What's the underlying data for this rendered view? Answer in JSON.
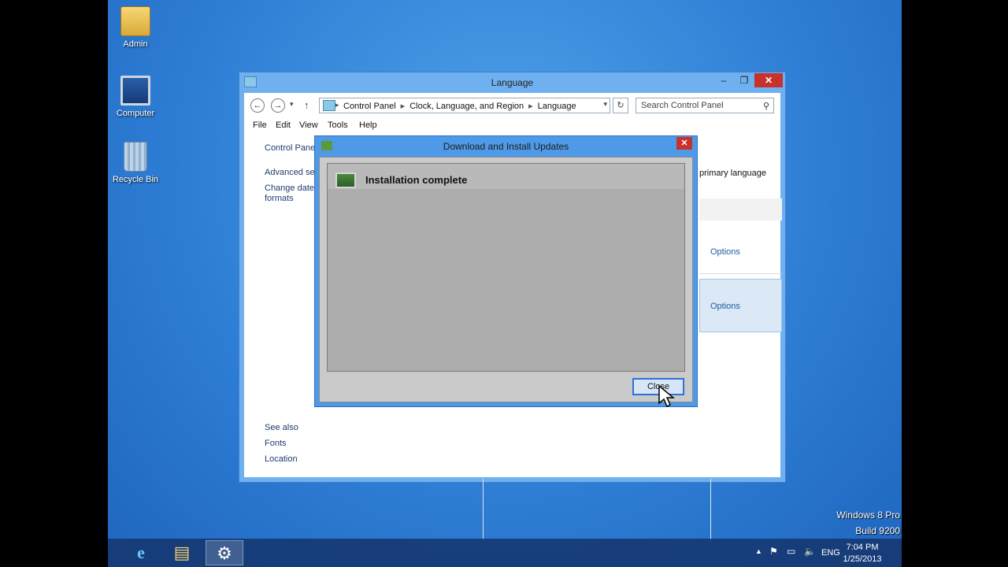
{
  "desktop": {
    "icons": [
      {
        "label": "Admin",
        "icon": "user-folder-icon"
      },
      {
        "label": "Computer",
        "icon": "computer-icon"
      },
      {
        "label": "Recycle Bin",
        "icon": "recycle-bin-icon"
      }
    ]
  },
  "window": {
    "title": "Language",
    "minimize": "–",
    "maximize": "❐",
    "close": "✕",
    "breadcrumb": [
      "Control Panel",
      "Clock, Language, and Region",
      "Language"
    ],
    "search_placeholder": "Search Control Panel",
    "menu": [
      "File",
      "Edit",
      "View",
      "Tools",
      "Help"
    ],
    "left_pane": {
      "home": "Control Panel",
      "advanced": "Advanced set",
      "change_date_1": "Change date,",
      "change_date_2": "formats"
    },
    "right_pane": {
      "primary_language_text": "primary language",
      "options_1": "Options",
      "options_2": "Options"
    },
    "see_also": {
      "heading": "See also",
      "fonts": "Fonts",
      "location": "Location"
    }
  },
  "dialog": {
    "title": "Download and Install Updates",
    "close": "✕",
    "status": "Installation complete",
    "close_button": "Close"
  },
  "taskbar": {
    "apps": [
      {
        "name": "internet-explorer",
        "glyph": "e"
      },
      {
        "name": "file-explorer",
        "glyph": "▤"
      },
      {
        "name": "control-panel",
        "glyph": "⚙"
      }
    ],
    "tray": {
      "language": "ENG",
      "time": "7:04 PM",
      "date": "1/25/2013"
    }
  },
  "watermark": {
    "line1": "Windows 8 Pro",
    "line2": "Build 9200"
  }
}
